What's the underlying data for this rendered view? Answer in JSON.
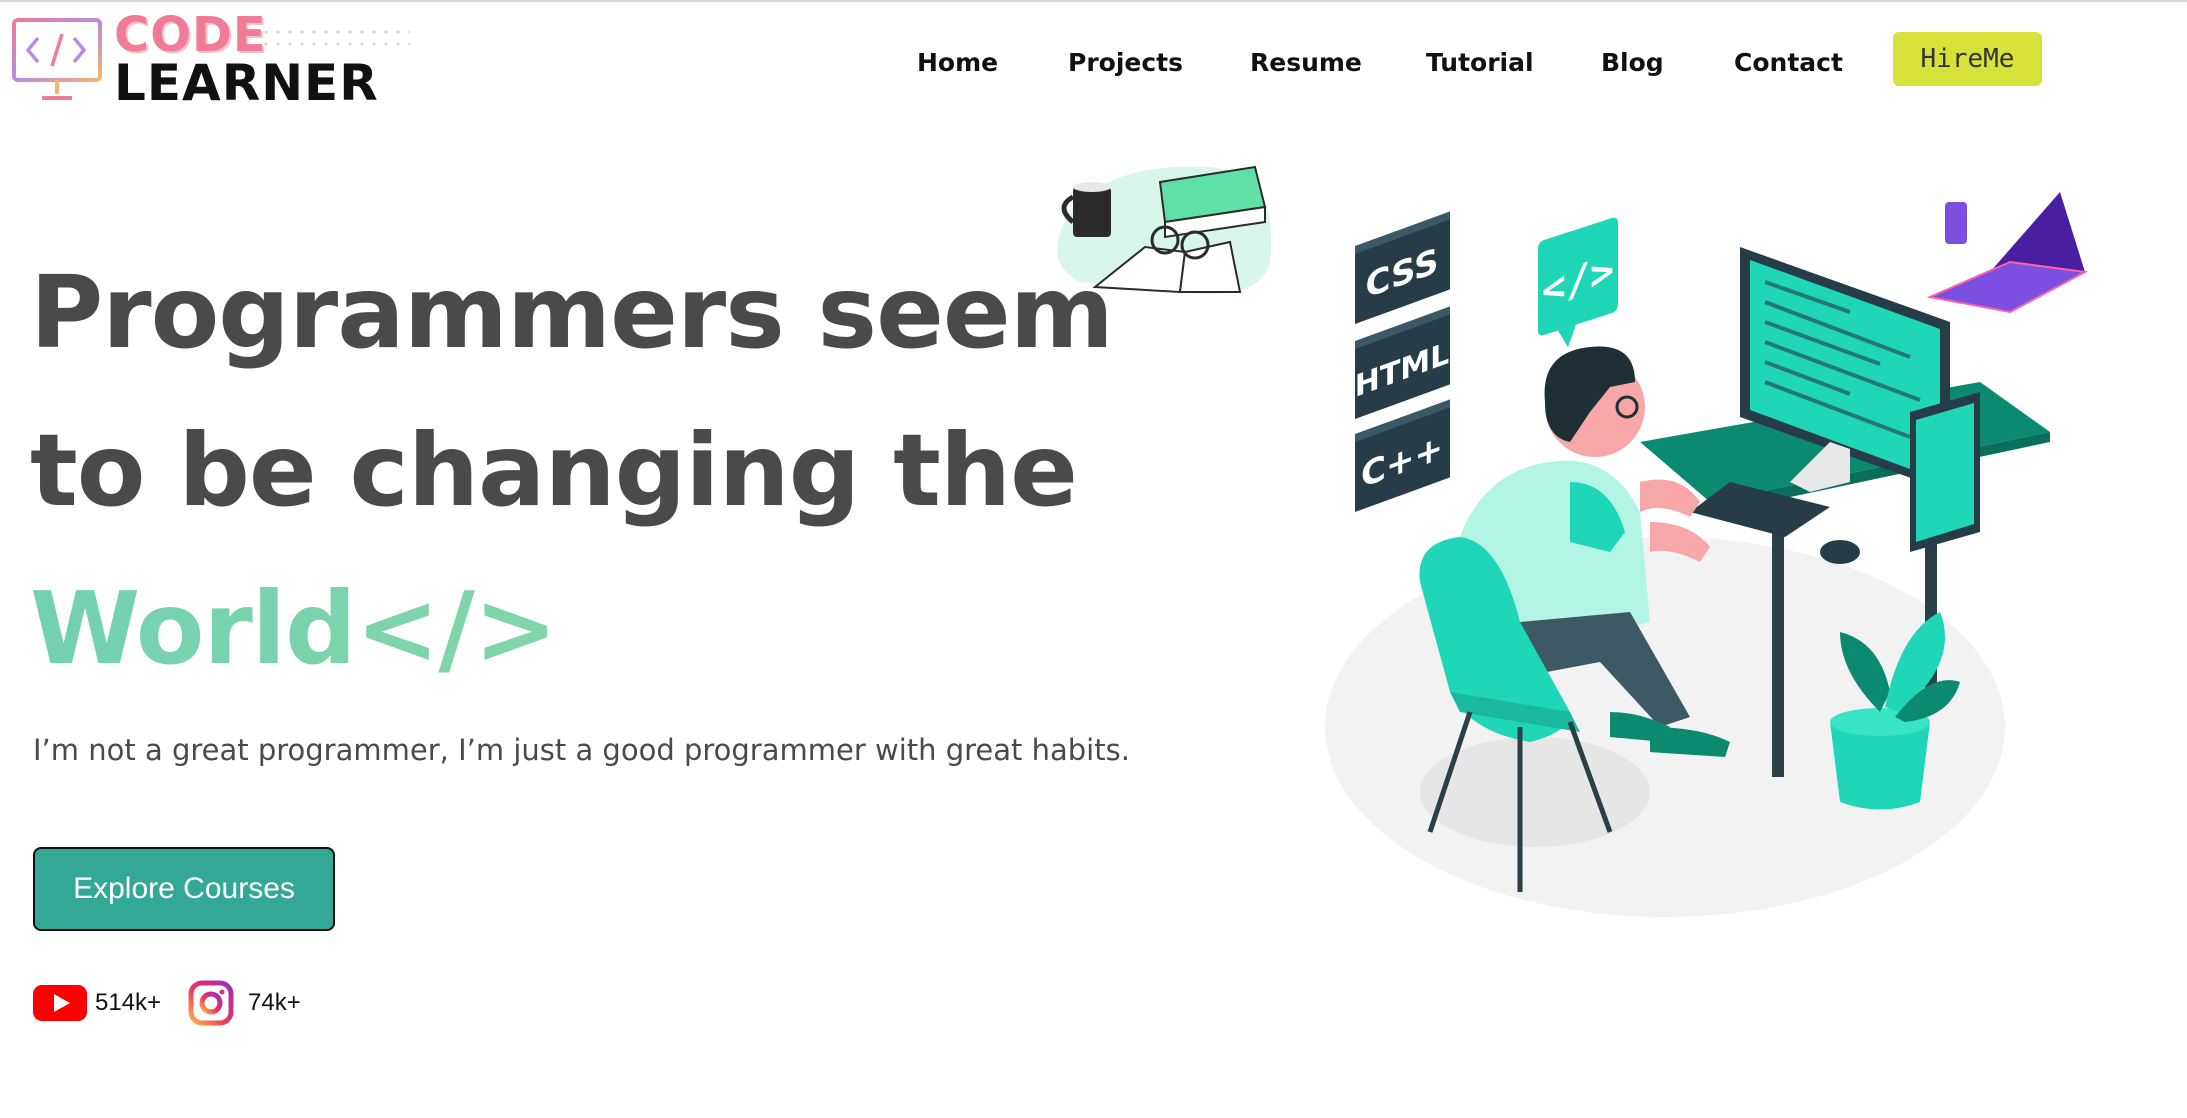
{
  "brand": {
    "line1": "CODE",
    "line2": "LEARNER",
    "icon": "code-monitor-icon",
    "colors": {
      "pink": "#f07b97",
      "dark": "#111111"
    }
  },
  "nav": {
    "items": [
      {
        "label": "Home"
      },
      {
        "label": "Projects"
      },
      {
        "label": "Resume"
      },
      {
        "label": "Tutorial"
      },
      {
        "label": "Blog"
      },
      {
        "label": "Contact"
      }
    ],
    "hire_label": "HireMe"
  },
  "hero": {
    "title_line1": "Programmers seem",
    "title_line2": "to be changing the",
    "title_line3": "World</>",
    "tagline": "I’m not a great programmer, I’m just a good programmer with great habits.",
    "cta_label": "Explore Courses"
  },
  "illustration": {
    "tiles": [
      "CSS",
      "HTML",
      "C++"
    ],
    "bubble_text": "</>"
  },
  "social": {
    "youtube": {
      "icon": "youtube-icon",
      "count": "514k+"
    },
    "instagram": {
      "icon": "instagram-icon",
      "count": "74k+"
    }
  },
  "colors": {
    "accent_teal": "#33a995",
    "hire_button": "#d6e23a",
    "heading": "#4a4a4a",
    "illustration_teal": "#1fd6b9"
  }
}
